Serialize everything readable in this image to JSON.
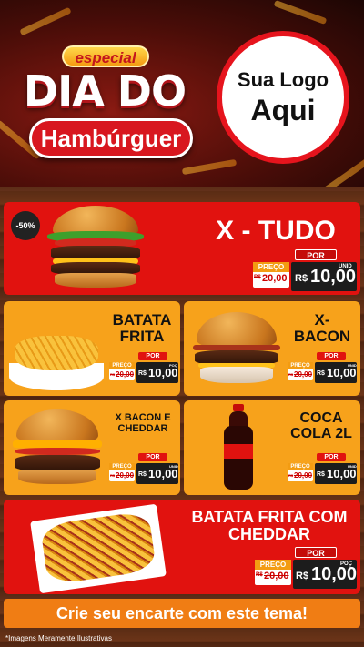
{
  "header": {
    "especial": "especial",
    "title": "DIA DO",
    "subtitle": "Hambúrguer",
    "logo_placeholder_line1": "Sua Logo",
    "logo_placeholder_line2": "Aqui"
  },
  "products": [
    {
      "id": "x-tudo",
      "title": "X - TUDO",
      "discount_badge": "-50%",
      "por_label": "POR",
      "preco_label": "PREÇO",
      "old_price_prefix": "R$",
      "old_price": "20,00",
      "currency": "R$",
      "price": "10,00",
      "unit": "UNID",
      "card_color": "#e1120f"
    },
    {
      "id": "batata-frita",
      "title": "BATATA FRITA",
      "por_label": "POR",
      "preco_label": "PREÇO",
      "old_price_prefix": "R$",
      "old_price": "20,00",
      "currency": "R$",
      "price": "10,00",
      "unit": "POÇ",
      "card_color": "#f7a21b"
    },
    {
      "id": "x-bacon",
      "title": "X- BACON",
      "por_label": "POR",
      "preco_label": "PREÇO",
      "old_price_prefix": "R$",
      "old_price": "20,00",
      "currency": "R$",
      "price": "10,00",
      "unit": "UNID",
      "card_color": "#f7a21b"
    },
    {
      "id": "x-bacon-cheddar",
      "title": "X BACON E CHEDDAR",
      "por_label": "POR",
      "preco_label": "PREÇO",
      "old_price_prefix": "R$",
      "old_price": "20,00",
      "currency": "R$",
      "price": "10,00",
      "unit": "UNID",
      "card_color": "#f7a21b"
    },
    {
      "id": "coca-cola",
      "title": "COCA COLA 2L",
      "por_label": "POR",
      "preco_label": "PREÇO",
      "old_price_prefix": "R$",
      "old_price": "20,00",
      "currency": "R$",
      "price": "10,00",
      "unit": "UNID",
      "card_color": "#f7a21b"
    },
    {
      "id": "batata-cheddar",
      "title": "BATATA FRITA COM CHEDDAR",
      "por_label": "POR",
      "preco_label": "PREÇO",
      "old_price_prefix": "R$",
      "old_price": "20,00",
      "currency": "R$",
      "price": "10,00",
      "unit": "POÇ",
      "card_color": "#e1120f"
    }
  ],
  "cta": "Crie seu encarte com este tema!",
  "disclaimer": "*Imagens Meramente Ilustrativas",
  "colors": {
    "red": "#e1120f",
    "orange": "#f7a21b",
    "dark": "#1c1c1c",
    "cta_orange": "#f07d14"
  }
}
